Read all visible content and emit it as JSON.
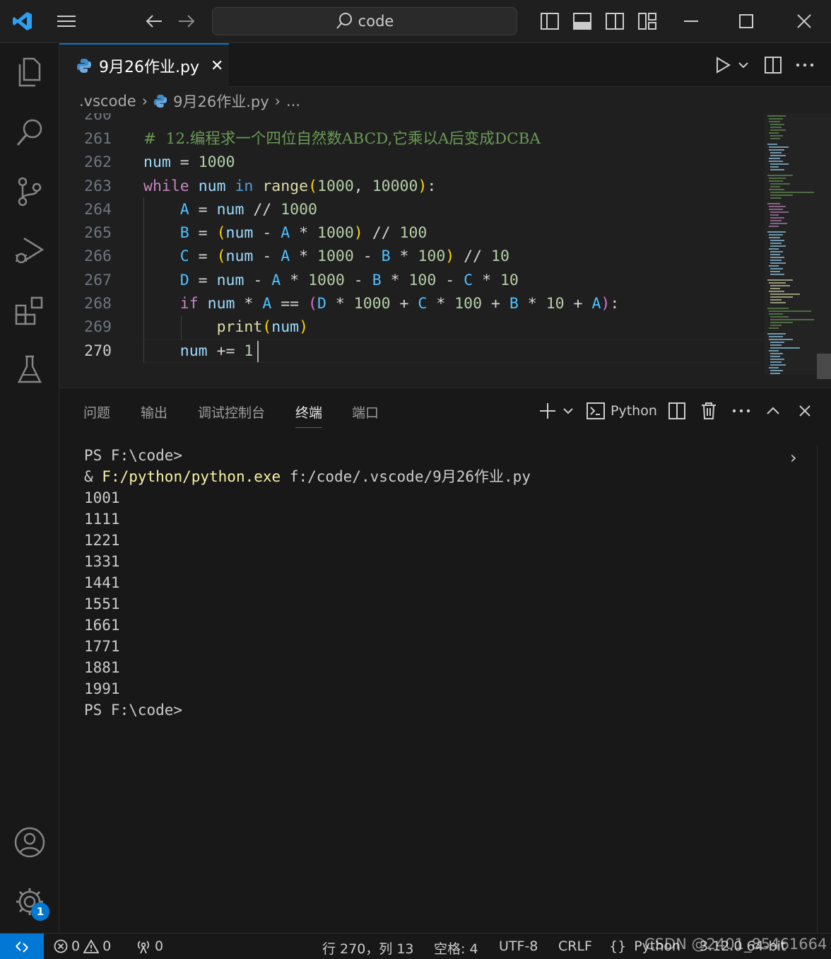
{
  "titlebar": {
    "search_text": "code",
    "icons": [
      "vscode-logo-icon",
      "menu-icon",
      "back-arrow-icon",
      "forward-arrow-icon",
      "search-icon",
      "toggle-sidebar-icon",
      "toggle-panel-icon",
      "toggle-secondary-sidebar-icon",
      "customize-layout-icon",
      "minimize-icon",
      "maximize-icon",
      "close-icon"
    ]
  },
  "activitybar": {
    "items": [
      "explorer-icon",
      "search-icon",
      "source-control-icon",
      "run-debug-icon",
      "extensions-icon",
      "testing-icon"
    ],
    "bottom": [
      "accounts-icon",
      "settings-gear-icon"
    ],
    "settings_badge": "1"
  },
  "tab": {
    "filename": "9月26作业.py",
    "close": "✕",
    "actions": [
      "run-icon",
      "chevron-down-icon",
      "split-editor-icon",
      "more-actions-icon"
    ]
  },
  "breadcrumb": {
    "folder": ".vscode",
    "file": "9月26作业.py",
    "tail": "..."
  },
  "editor": {
    "line_numbers": [
      "260",
      "261",
      "262",
      "263",
      "264",
      "265",
      "266",
      "267",
      "268",
      "269",
      "270"
    ],
    "current_line": "270",
    "comment_text": "#  12.编程求一个四位自然数ABCD,它乘以A后变成DCBA"
  },
  "panel": {
    "tabs": [
      "问题",
      "输出",
      "调试控制台",
      "终端",
      "端口"
    ],
    "active_tab": "终端",
    "terminal_name": "Python",
    "terminal": {
      "prompt": "PS F:\\code>",
      "cmd_amp": "& ",
      "cmd_exe": "F:/python/python.exe",
      "cmd_arg": " f:/code/.vscode/9月26作业.py",
      "output": [
        "1001",
        "1111",
        "1221",
        "1331",
        "1441",
        "1551",
        "1661",
        "1771",
        "1881",
        "1991"
      ],
      "prompt_end": "PS F:\\code>"
    }
  },
  "statusbar": {
    "errors": "0",
    "warnings": "0",
    "ports": "0",
    "position": "行 270，列 13",
    "spaces": "空格: 4",
    "encoding": "UTF-8",
    "eol": "CRLF",
    "language": "Python",
    "interpreter": "3.12.0 64-bit",
    "watermark": "CSDN @2401_85461664"
  },
  "colors": {
    "accent": "#0078d4",
    "editor_bg": "#1f1f1f",
    "panel_bg": "#181818"
  }
}
